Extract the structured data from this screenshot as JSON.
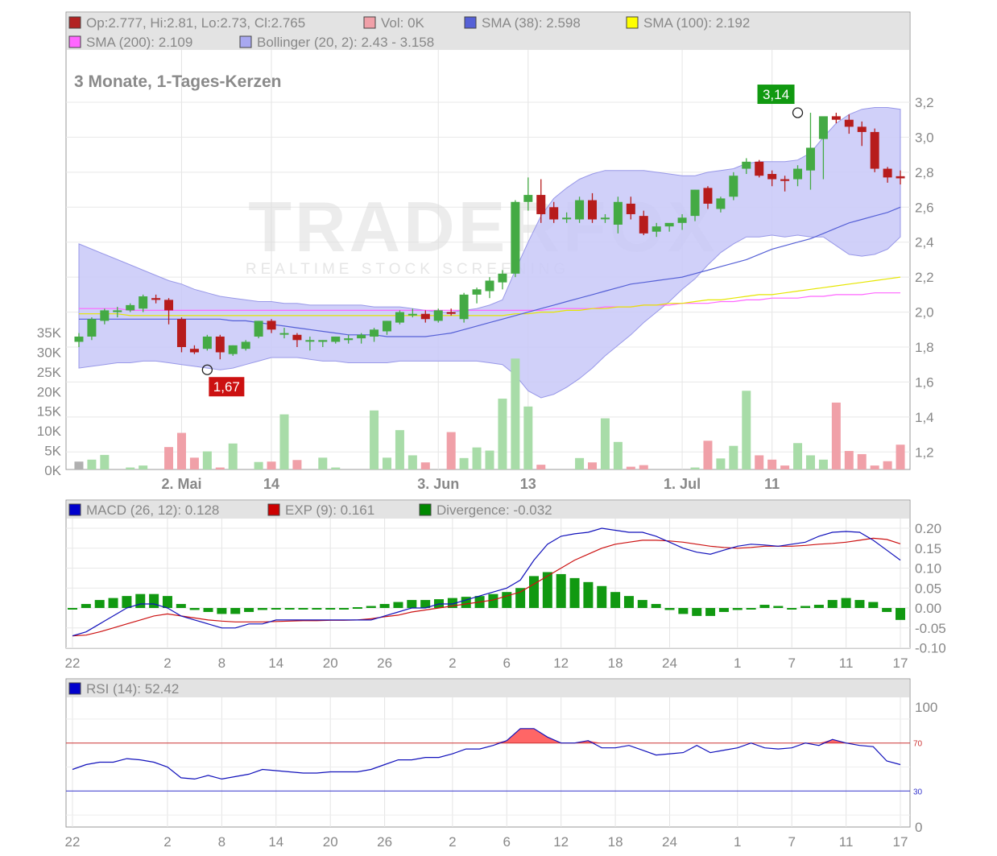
{
  "chart_data": [
    {
      "type": "candlestick",
      "subtitle": "3 Monate, 1-Tages-Kerzen",
      "watermark": {
        "brand": "TRADERFOX",
        "tagline": "REALTIME STOCK SCREENING"
      },
      "legend": [
        {
          "label": "Op:2.777, Hi:2.81, Lo:2.73, Cl:2.765",
          "color": "#b22222"
        },
        {
          "label": "Vol: 0K",
          "color": "#f0a0a8"
        },
        {
          "label": "SMA (38): 2.598",
          "color": "#5560d6"
        },
        {
          "label": "SMA (100): 2.192",
          "color": "#ffff00"
        },
        {
          "label": "SMA (200): 2.109",
          "color": "#ff66ff"
        },
        {
          "label": "Bollinger (20, 2): 2.43 - 3.158",
          "color": "#a8a8f0"
        }
      ],
      "x_tick_labels": [
        "2. Mai",
        "14",
        "3. Jun",
        "13",
        "1. Jul",
        "11"
      ],
      "x_tick_index": [
        8,
        15,
        28,
        35,
        47,
        54
      ],
      "y_ticks": [
        "1,2",
        "1,4",
        "1,6",
        "1,8",
        "2,0",
        "2,2",
        "2,4",
        "2,6",
        "2,8",
        "3,0",
        "3,2"
      ],
      "ylim": [
        1.1,
        3.3
      ],
      "volume_ticks": [
        "0K",
        "5K",
        "10K",
        "15K",
        "20K",
        "25K",
        "30K",
        "35K"
      ],
      "volume_ylim": [
        0,
        35000
      ],
      "min_label": {
        "text": "1,67",
        "index": 10,
        "value": 1.67
      },
      "max_label": {
        "text": "3,14",
        "index": 56,
        "value": 3.14
      },
      "candles": [
        [
          1.83,
          1.88,
          1.8,
          1.86
        ],
        [
          1.86,
          1.97,
          1.84,
          1.96
        ],
        [
          1.95,
          2.02,
          1.93,
          2.01
        ],
        [
          2.0,
          2.03,
          1.97,
          2.01
        ],
        [
          2.01,
          2.05,
          2.0,
          2.04
        ],
        [
          2.02,
          2.1,
          2.0,
          2.09
        ],
        [
          2.08,
          2.1,
          2.05,
          2.07
        ],
        [
          2.07,
          2.08,
          1.93,
          2.01
        ],
        [
          1.96,
          1.97,
          1.77,
          1.8
        ],
        [
          1.79,
          1.81,
          1.76,
          1.77
        ],
        [
          1.79,
          1.87,
          1.78,
          1.86
        ],
        [
          1.86,
          1.87,
          1.73,
          1.77
        ],
        [
          1.76,
          1.81,
          1.75,
          1.81
        ],
        [
          1.79,
          1.84,
          1.78,
          1.83
        ],
        [
          1.86,
          1.95,
          1.85,
          1.95
        ],
        [
          1.95,
          1.96,
          1.88,
          1.9
        ],
        [
          1.88,
          1.91,
          1.85,
          1.88
        ],
        [
          1.87,
          1.88,
          1.8,
          1.84
        ],
        [
          1.84,
          1.86,
          1.78,
          1.84
        ],
        [
          1.83,
          1.84,
          1.8,
          1.84
        ],
        [
          1.83,
          1.86,
          1.82,
          1.86
        ],
        [
          1.84,
          1.87,
          1.82,
          1.85
        ],
        [
          1.85,
          1.88,
          1.82,
          1.87
        ],
        [
          1.86,
          1.91,
          1.83,
          1.9
        ],
        [
          1.89,
          1.95,
          1.87,
          1.95
        ],
        [
          1.94,
          2.01,
          1.93,
          2.0
        ],
        [
          1.99,
          2.02,
          1.97,
          1.99
        ],
        [
          1.99,
          2.01,
          1.94,
          1.96
        ],
        [
          1.95,
          2.02,
          1.94,
          2.01
        ],
        [
          2.0,
          2.02,
          1.98,
          1.99
        ],
        [
          1.96,
          2.11,
          1.94,
          2.1
        ],
        [
          2.1,
          2.14,
          2.05,
          2.13
        ],
        [
          2.12,
          2.2,
          2.08,
          2.18
        ],
        [
          2.17,
          2.24,
          2.13,
          2.22
        ],
        [
          2.22,
          2.64,
          2.2,
          2.63
        ],
        [
          2.63,
          2.77,
          2.58,
          2.67
        ],
        [
          2.67,
          2.76,
          2.51,
          2.56
        ],
        [
          2.6,
          2.63,
          2.51,
          2.53
        ],
        [
          2.54,
          2.57,
          2.51,
          2.54
        ],
        [
          2.53,
          2.66,
          2.51,
          2.64
        ],
        [
          2.64,
          2.68,
          2.51,
          2.53
        ],
        [
          2.54,
          2.56,
          2.51,
          2.54
        ],
        [
          2.5,
          2.66,
          2.45,
          2.63
        ],
        [
          2.62,
          2.66,
          2.53,
          2.56
        ],
        [
          2.55,
          2.58,
          2.44,
          2.45
        ],
        [
          2.46,
          2.51,
          2.43,
          2.49
        ],
        [
          2.49,
          2.5,
          2.46,
          2.51
        ],
        [
          2.51,
          2.56,
          2.47,
          2.54
        ],
        [
          2.55,
          2.7,
          2.52,
          2.7
        ],
        [
          2.71,
          2.72,
          2.59,
          2.62
        ],
        [
          2.59,
          2.66,
          2.57,
          2.65
        ],
        [
          2.66,
          2.8,
          2.64,
          2.78
        ],
        [
          2.82,
          2.88,
          2.79,
          2.86
        ],
        [
          2.86,
          2.87,
          2.77,
          2.78
        ],
        [
          2.79,
          2.81,
          2.72,
          2.76
        ],
        [
          2.76,
          2.78,
          2.69,
          2.75
        ],
        [
          2.76,
          2.84,
          2.72,
          2.82
        ],
        [
          2.81,
          3.14,
          2.7,
          2.94
        ],
        [
          2.99,
          3.1,
          2.76,
          3.12
        ],
        [
          3.12,
          3.14,
          3.08,
          3.1
        ],
        [
          3.1,
          3.13,
          3.02,
          3.06
        ],
        [
          3.06,
          3.09,
          2.95,
          3.03
        ],
        [
          3.03,
          3.05,
          2.8,
          2.82
        ],
        [
          2.82,
          2.83,
          2.74,
          2.77
        ],
        [
          2.777,
          2.81,
          2.73,
          2.765
        ]
      ],
      "volume": [
        1500,
        2500,
        3700,
        0,
        500,
        1000,
        0,
        5700,
        9300,
        3000,
        4600,
        500,
        6600,
        0,
        1900,
        2000,
        14000,
        2400,
        0,
        3000,
        500,
        0,
        0,
        15000,
        3000,
        10000,
        3600,
        1800,
        0,
        9500,
        2900,
        5600,
        4800,
        18000,
        28200,
        16000,
        1200,
        0,
        0,
        2900,
        1800,
        13000,
        7000,
        700,
        1100,
        0,
        0,
        0,
        500,
        7300,
        2800,
        6000,
        20000,
        3600,
        2500,
        1000,
        6700,
        3600,
        2500,
        17000,
        4700,
        3900,
        1000,
        2100,
        6300
      ],
      "sma38": [
        1.96,
        1.96,
        1.96,
        1.96,
        1.96,
        1.96,
        1.96,
        1.96,
        1.96,
        1.96,
        1.96,
        1.96,
        1.95,
        1.95,
        1.94,
        1.93,
        1.92,
        1.91,
        1.9,
        1.89,
        1.88,
        1.87,
        1.87,
        1.87,
        1.86,
        1.86,
        1.86,
        1.86,
        1.87,
        1.88,
        1.9,
        1.92,
        1.94,
        1.96,
        1.98,
        2.0,
        2.02,
        2.04,
        2.06,
        2.08,
        2.1,
        2.12,
        2.14,
        2.16,
        2.17,
        2.18,
        2.19,
        2.2,
        2.22,
        2.24,
        2.26,
        2.28,
        2.3,
        2.33,
        2.36,
        2.38,
        2.4,
        2.42,
        2.45,
        2.48,
        2.51,
        2.53,
        2.55,
        2.57,
        2.6
      ],
      "sma100": [
        1.99,
        1.99,
        1.99,
        1.99,
        1.98,
        1.98,
        1.98,
        1.98,
        1.98,
        1.98,
        1.98,
        1.98,
        1.98,
        1.98,
        1.98,
        1.98,
        1.98,
        1.98,
        1.98,
        1.98,
        1.98,
        1.98,
        1.98,
        1.98,
        1.98,
        1.98,
        1.98,
        1.98,
        1.98,
        1.98,
        1.98,
        1.98,
        1.98,
        1.98,
        1.99,
        1.99,
        2.0,
        2.0,
        2.01,
        2.01,
        2.02,
        2.02,
        2.03,
        2.03,
        2.04,
        2.04,
        2.05,
        2.05,
        2.06,
        2.07,
        2.07,
        2.08,
        2.09,
        2.1,
        2.1,
        2.11,
        2.12,
        2.13,
        2.14,
        2.15,
        2.16,
        2.17,
        2.18,
        2.19,
        2.2
      ],
      "sma200": [
        2.02,
        2.02,
        2.02,
        2.02,
        2.01,
        2.01,
        2.01,
        2.01,
        2.01,
        2.01,
        2.01,
        2.01,
        2.01,
        2.01,
        2.01,
        2.01,
        2.01,
        2.01,
        2.01,
        2.01,
        2.01,
        2.01,
        2.01,
        2.01,
        2.01,
        2.01,
        2.01,
        2.01,
        2.01,
        2.01,
        2.01,
        2.01,
        2.01,
        2.01,
        2.01,
        2.01,
        2.01,
        2.02,
        2.02,
        2.02,
        2.02,
        2.03,
        2.03,
        2.03,
        2.04,
        2.04,
        2.04,
        2.05,
        2.05,
        2.05,
        2.06,
        2.06,
        2.07,
        2.07,
        2.08,
        2.08,
        2.08,
        2.09,
        2.09,
        2.1,
        2.1,
        2.1,
        2.11,
        2.11,
        2.11
      ],
      "bollinger_upper": [
        2.39,
        2.36,
        2.33,
        2.3,
        2.27,
        2.24,
        2.21,
        2.18,
        2.16,
        2.13,
        2.11,
        2.09,
        2.08,
        2.07,
        2.06,
        2.06,
        2.05,
        2.05,
        2.04,
        2.04,
        2.04,
        2.04,
        2.04,
        2.03,
        2.03,
        2.03,
        2.02,
        2.01,
        2.0,
        2.0,
        2.01,
        2.02,
        2.04,
        2.07,
        2.24,
        2.4,
        2.55,
        2.65,
        2.71,
        2.76,
        2.79,
        2.81,
        2.81,
        2.81,
        2.81,
        2.8,
        2.79,
        2.78,
        2.78,
        2.8,
        2.81,
        2.82,
        2.85,
        2.86,
        2.86,
        2.86,
        2.87,
        2.91,
        3.0,
        3.08,
        3.13,
        3.16,
        3.17,
        3.17,
        3.16
      ],
      "bollinger_lower": [
        1.68,
        1.69,
        1.7,
        1.71,
        1.71,
        1.72,
        1.72,
        1.71,
        1.7,
        1.69,
        1.68,
        1.67,
        1.68,
        1.7,
        1.72,
        1.74,
        1.74,
        1.74,
        1.73,
        1.72,
        1.72,
        1.71,
        1.71,
        1.71,
        1.71,
        1.72,
        1.72,
        1.72,
        1.72,
        1.72,
        1.72,
        1.72,
        1.71,
        1.7,
        1.64,
        1.55,
        1.51,
        1.53,
        1.57,
        1.62,
        1.68,
        1.75,
        1.81,
        1.87,
        1.94,
        2.0,
        2.06,
        2.13,
        2.19,
        2.27,
        2.34,
        2.39,
        2.43,
        2.43,
        2.44,
        2.43,
        2.44,
        2.43,
        2.43,
        2.38,
        2.33,
        2.32,
        2.33,
        2.36,
        2.43
      ]
    },
    {
      "type": "line",
      "legend": [
        {
          "label": "MACD (26, 12): 0.128",
          "color": "#0000cc"
        },
        {
          "label": "EXP (9): 0.161",
          "color": "#cc0000"
        },
        {
          "label": "Divergence: -0.032",
          "color": "#008800"
        }
      ],
      "y_ticks": [
        "0.20",
        "0.15",
        "0.10",
        "0.05",
        "0.00",
        "-0.05",
        "-0.10"
      ],
      "ylim": [
        -0.1,
        0.22
      ],
      "x_tick_labels": [
        "22",
        "2",
        "8",
        "14",
        "20",
        "26",
        "2",
        "6",
        "12",
        "18",
        "24",
        "1",
        "7",
        "11",
        "17"
      ],
      "x_tick_index": [
        0,
        7,
        11,
        15,
        19,
        23,
        28,
        32,
        36,
        40,
        44,
        49,
        53,
        57,
        61
      ],
      "macd": [
        -0.07,
        -0.06,
        -0.04,
        -0.02,
        0.0,
        0.01,
        0.01,
        0.0,
        -0.02,
        -0.03,
        -0.04,
        -0.05,
        -0.05,
        -0.04,
        -0.04,
        -0.03,
        -0.03,
        -0.03,
        -0.03,
        -0.03,
        -0.03,
        -0.03,
        -0.03,
        -0.02,
        -0.01,
        0.0,
        0.0,
        0.01,
        0.01,
        0.02,
        0.03,
        0.04,
        0.05,
        0.07,
        0.12,
        0.16,
        0.18,
        0.186,
        0.19,
        0.2,
        0.195,
        0.19,
        0.19,
        0.18,
        0.165,
        0.15,
        0.14,
        0.135,
        0.145,
        0.155,
        0.16,
        0.158,
        0.155,
        0.16,
        0.165,
        0.18,
        0.19,
        0.192,
        0.19,
        0.17,
        0.145,
        0.12
      ],
      "exp": [
        -0.07,
        -0.068,
        -0.06,
        -0.05,
        -0.04,
        -0.03,
        -0.02,
        -0.015,
        -0.02,
        -0.025,
        -0.03,
        -0.033,
        -0.035,
        -0.035,
        -0.035,
        -0.034,
        -0.033,
        -0.032,
        -0.032,
        -0.031,
        -0.031,
        -0.03,
        -0.027,
        -0.022,
        -0.018,
        -0.01,
        -0.005,
        0.0,
        0.005,
        0.01,
        0.015,
        0.02,
        0.03,
        0.04,
        0.06,
        0.08,
        0.1,
        0.12,
        0.135,
        0.15,
        0.16,
        0.165,
        0.17,
        0.17,
        0.168,
        0.165,
        0.16,
        0.155,
        0.152,
        0.15,
        0.152,
        0.155,
        0.155,
        0.155,
        0.157,
        0.16,
        0.162,
        0.165,
        0.17,
        0.175,
        0.172,
        0.161
      ],
      "divergence": [
        0.0,
        0.01,
        0.02,
        0.025,
        0.03,
        0.035,
        0.035,
        0.03,
        0.01,
        -0.005,
        -0.01,
        -0.015,
        -0.015,
        -0.01,
        -0.005,
        -0.002,
        0.0,
        0.0,
        0.0,
        0.0,
        0.0,
        0.002,
        0.005,
        0.01,
        0.015,
        0.02,
        0.02,
        0.022,
        0.025,
        0.028,
        0.03,
        0.035,
        0.04,
        0.05,
        0.08,
        0.09,
        0.085,
        0.075,
        0.065,
        0.055,
        0.04,
        0.03,
        0.02,
        0.01,
        -0.005,
        -0.015,
        -0.02,
        -0.02,
        -0.01,
        -0.005,
        0.0,
        0.008,
        0.005,
        0.0,
        0.005,
        0.008,
        0.02,
        0.025,
        0.02,
        0.015,
        -0.01,
        -0.03
      ]
    },
    {
      "type": "line",
      "legend": [
        {
          "label": "RSI (14): 52.42",
          "color": "#0000cc"
        }
      ],
      "y_ticks": [
        "0",
        "100"
      ],
      "ylim": [
        0,
        110
      ],
      "reference_lines": [
        {
          "value": 70,
          "label": "70",
          "color": "#cc3333"
        },
        {
          "value": 30,
          "label": "30",
          "color": "#3333cc"
        }
      ],
      "x_tick_labels": [
        "22",
        "2",
        "8",
        "14",
        "20",
        "26",
        "2",
        "6",
        "12",
        "18",
        "24",
        "1",
        "7",
        "11",
        "17"
      ],
      "x_tick_index": [
        0,
        7,
        11,
        15,
        19,
        23,
        28,
        32,
        36,
        40,
        44,
        49,
        53,
        57,
        61
      ],
      "rsi": [
        48,
        52,
        54,
        54,
        57,
        56,
        54,
        50,
        41,
        40,
        43,
        40,
        42,
        44,
        48,
        47,
        46,
        45,
        45,
        46,
        46,
        46,
        48,
        52,
        56,
        56,
        58,
        58,
        61,
        65,
        65,
        68,
        72,
        82,
        82,
        75,
        70,
        70,
        72,
        66,
        66,
        68,
        64,
        60,
        61,
        62,
        68,
        62,
        64,
        66,
        70,
        66,
        65,
        66,
        70,
        68,
        73,
        70,
        68,
        67,
        55,
        52
      ]
    }
  ]
}
